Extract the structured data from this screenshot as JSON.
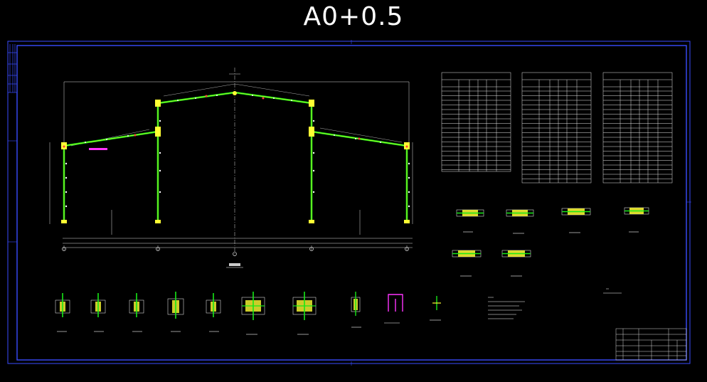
{
  "sheet": {
    "title": "A0+0.5"
  },
  "colors": {
    "background": "#000000",
    "frame": "#3a4cff",
    "member": "#17e817",
    "member_core": "#ffff33",
    "dimension": "#ffffff",
    "highlight": "#ff33ff"
  },
  "icons": {
    "frame_axis_symbol": "axis-cross-icon"
  }
}
